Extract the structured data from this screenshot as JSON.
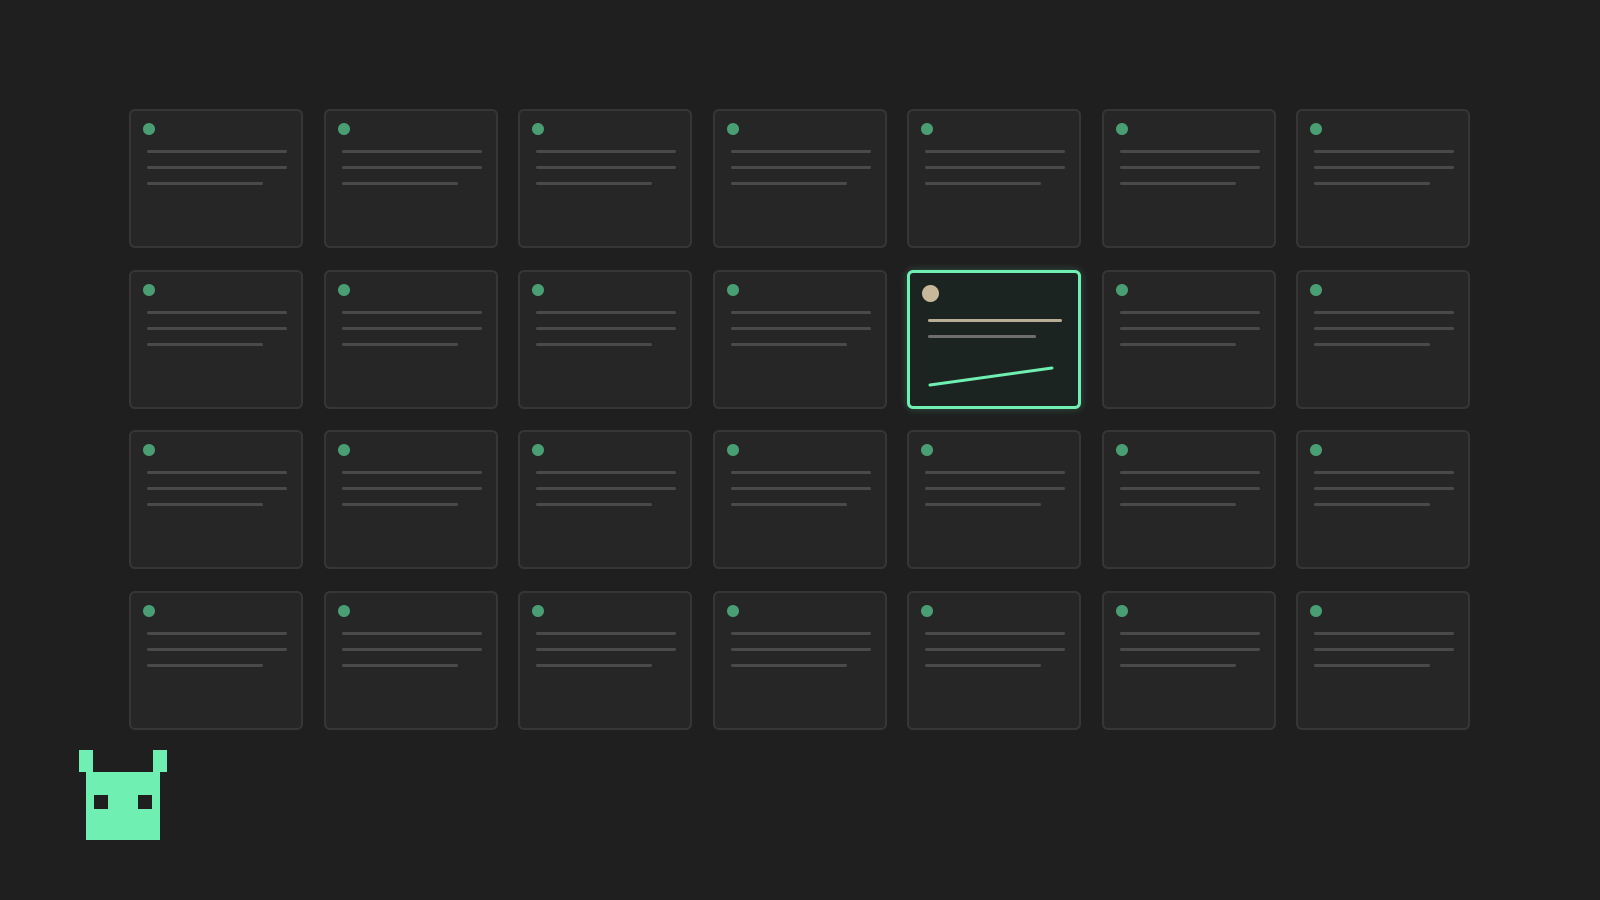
{
  "grid": {
    "rows": 4,
    "columns": 7,
    "selected_index": 11
  },
  "colors": {
    "background": "#1f1f1f",
    "card": "#262626",
    "card_border": "#363636",
    "status_dot": "#4a9e73",
    "accent": "#6ff0b2",
    "selected_dot": "#c8b89a"
  },
  "icons": {
    "mascot": "pixel-robot-icon",
    "status": "status-dot-icon",
    "trend": "trend-line-icon"
  }
}
